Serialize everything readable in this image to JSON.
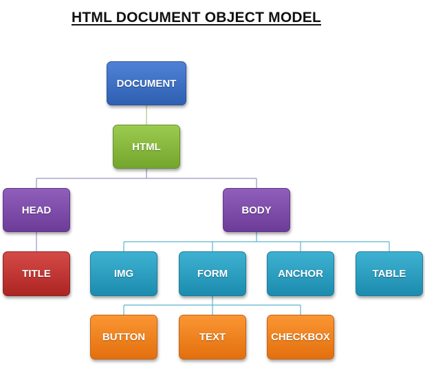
{
  "title": "HTML DOCUMENT OBJECT MODEL",
  "nodes": {
    "document": "DOCUMENT",
    "html": "HTML",
    "head": "HEAD",
    "body": "BODY",
    "title": "TITLE",
    "img": "IMG",
    "form": "FORM",
    "anchor": "ANCHOR",
    "table": "TABLE",
    "button": "BUTTON",
    "text": "TEXT",
    "checkbox": "CHECKBOX"
  },
  "colors": {
    "document": "#3a6fc4",
    "html": "#86b83d",
    "head_body": "#7b4aa8",
    "title": "#c0302e",
    "body_children": "#2a9ec0",
    "form_children": "#f0821f",
    "connector_html_level": "#8e86b5",
    "connector_body_level": "#5ab3cf"
  }
}
